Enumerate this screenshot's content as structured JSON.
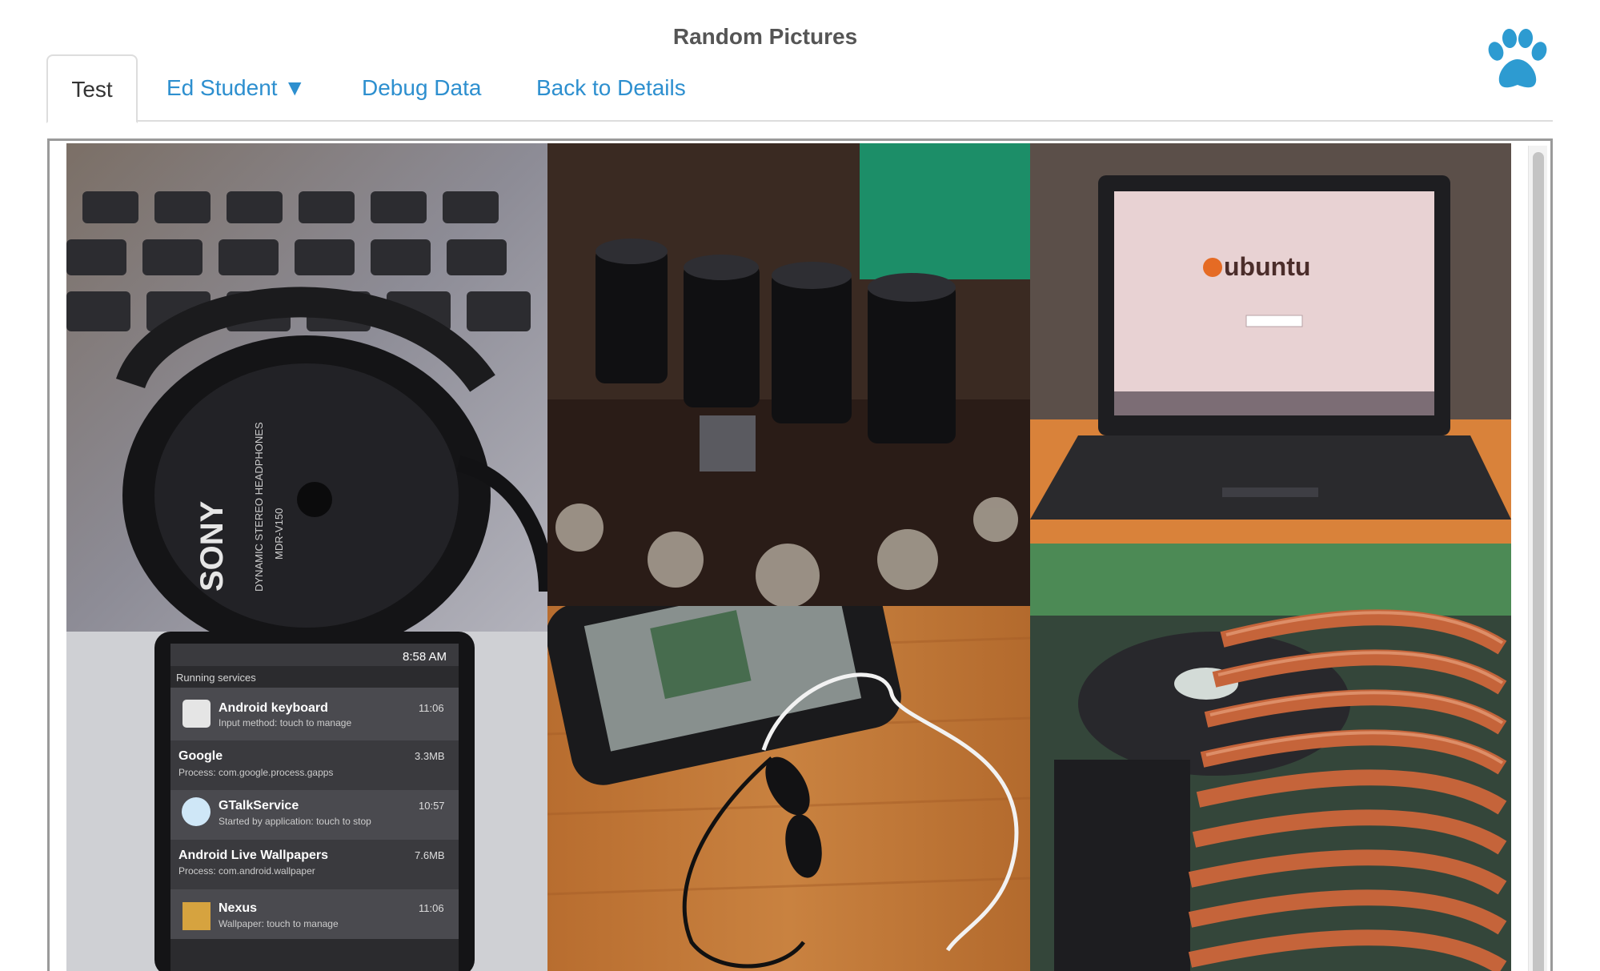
{
  "header": {
    "title": "Random Pictures"
  },
  "tabs": [
    {
      "label": "Test",
      "active": true
    },
    {
      "label": "Ed Student ▼",
      "active": false
    },
    {
      "label": "Debug Data",
      "active": false
    },
    {
      "label": "Back to Details",
      "active": false
    }
  ],
  "colors": {
    "link": "#2d8fcf",
    "paw": "#2d9bd1",
    "active_tab_text": "#333333"
  },
  "icons": {
    "brand": "paw-icon"
  },
  "gallery": {
    "headphones": {
      "brand": "SONY",
      "line1": "DYNAMIC STEREO HEADPHONES",
      "line2": "MDR-V150"
    },
    "laptop": {
      "logo_text": "ubuntu"
    },
    "phone": {
      "time": "8:58 AM",
      "header": "Running services",
      "items": [
        {
          "title": "Android keyboard",
          "subtitle": "Input method: touch to manage",
          "right": "11:06"
        },
        {
          "title": "Google",
          "subtitle": "Process: com.google.process.gapps",
          "right": "3.3MB"
        },
        {
          "title": "GTalkService",
          "subtitle": "Started by application: touch to stop",
          "right": "10:57"
        },
        {
          "title": "Android Live Wallpapers",
          "subtitle": "Process: com.android.wallpaper",
          "right": "7.6MB"
        },
        {
          "title": "Nexus",
          "subtitle": "Wallpaper: touch to manage",
          "right": "11:06"
        }
      ]
    }
  }
}
